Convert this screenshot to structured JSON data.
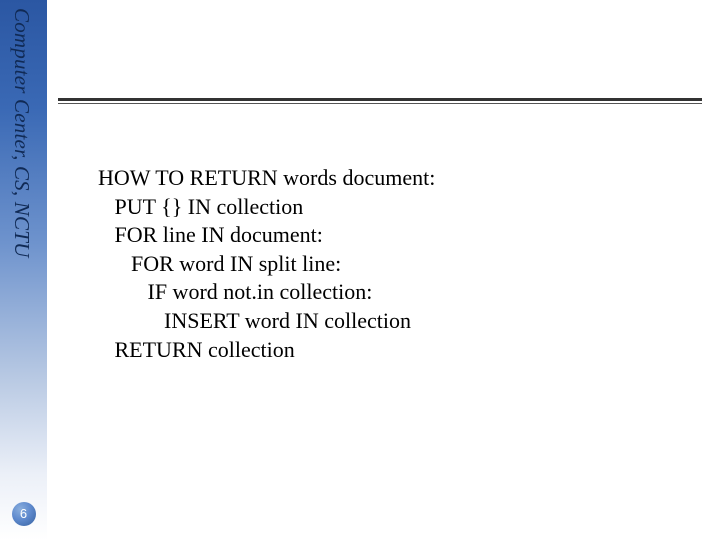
{
  "sidebar": {
    "org_text": "Computer Center, CS, NCTU"
  },
  "page": {
    "number": "6"
  },
  "code": {
    "l0": "HOW TO RETURN words document:",
    "l1": "   PUT {} IN collection",
    "l2": "   FOR line IN document:",
    "l3": "      FOR word IN split line:",
    "l4": "         IF word not.in collection:",
    "l5": "            INSERT word IN collection",
    "l6": "   RETURN collection"
  }
}
